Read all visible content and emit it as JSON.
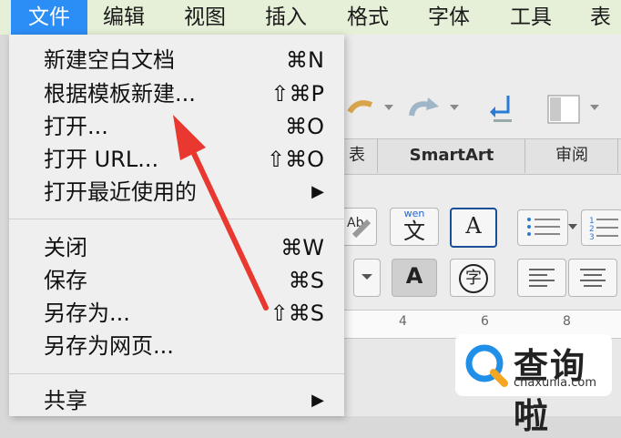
{
  "menubar": {
    "items": [
      {
        "label": "文件"
      },
      {
        "label": "编辑"
      },
      {
        "label": "视图"
      },
      {
        "label": "插入"
      },
      {
        "label": "格式"
      },
      {
        "label": "字体"
      },
      {
        "label": "工具"
      },
      {
        "label": "表格"
      }
    ]
  },
  "file_menu": {
    "items": [
      {
        "label": "新建空白文档",
        "shortcut": "⌘N"
      },
      {
        "label": "根据模板新建...",
        "shortcut": "⇧⌘P"
      },
      {
        "label": "打开...",
        "shortcut": "⌘O"
      },
      {
        "label": "打开 URL...",
        "shortcut": "⇧⌘O"
      },
      {
        "label": "打开最近使用的",
        "shortcut": "▶"
      },
      {
        "label": "关闭",
        "shortcut": "⌘W"
      },
      {
        "label": "保存",
        "shortcut": "⌘S"
      },
      {
        "label": "另存为...",
        "shortcut": "⇧⌘S"
      },
      {
        "label": "另存为网页...",
        "shortcut": ""
      },
      {
        "label": "共享",
        "shortcut": "▶"
      }
    ]
  },
  "ribbon": {
    "tabs": [
      "SmartArt",
      "审阅"
    ],
    "partial_tab": "表"
  },
  "styles": {
    "wen_top": "wen",
    "wen_char": "文",
    "a_char": "A",
    "a_shaded": "A",
    "zi_char": "字"
  },
  "ruler": {
    "marks": [
      "4",
      "6",
      "8"
    ]
  },
  "watermark": {
    "text": "查询啦",
    "url": "chaxunla.com"
  },
  "colors": {
    "menubar_bg": "#e6f0d8",
    "highlight": "#2b8ef6",
    "arrow": "#e8382f",
    "logo_blue": "#1f8fe8",
    "logo_orange": "#f5a623"
  }
}
